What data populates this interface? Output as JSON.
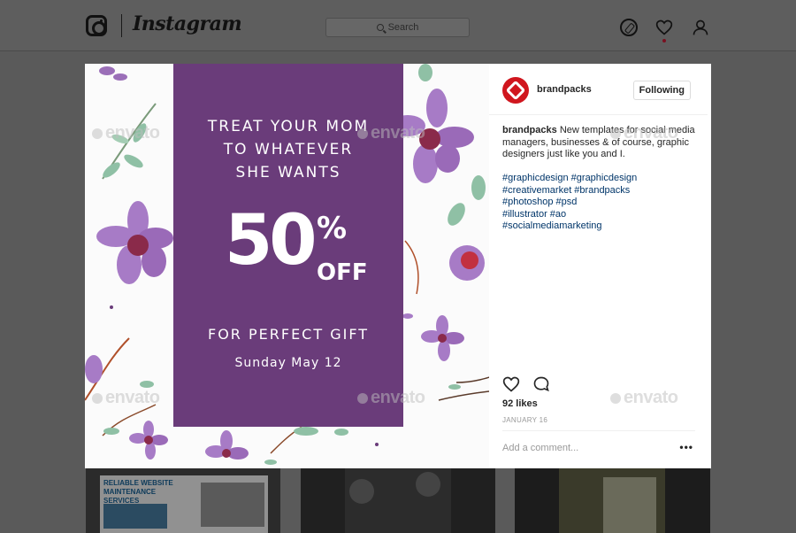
{
  "header": {
    "brand": "Instagram",
    "search_placeholder": "Search"
  },
  "post": {
    "promo": {
      "line1": "TREAT YOUR MOM",
      "line2": "TO WHATEVER",
      "line3": "SHE WANTS",
      "big_number": "50",
      "percent_sign": "%",
      "off": "OFF",
      "gift": "FOR PERFECT GIFT",
      "date": "Sunday May 12"
    },
    "watermark": "envato",
    "author": "brandpacks",
    "follow_label": "Following",
    "caption_text": "New templates for social media managers, businesses & of course, graphic designers just like you and I.",
    "hashtags": [
      "#graphicdesign #graphicdesign",
      "#creativemarket #brandpacks",
      "#photoshop #psd",
      "#illustrator #ao",
      "#socialmediamarketing"
    ],
    "likes": "92 likes",
    "date": "JANUARY 16",
    "comment_placeholder": "Add a comment...",
    "more": "•••"
  },
  "thumbnails": {
    "thumb1_text": "RELIABLE WEBSITE MAINTENANCE SERVICES"
  },
  "colors": {
    "promo_purple": "#6a3c7a",
    "avatar_red": "#d0161e",
    "hashtag_blue": "#003569"
  }
}
